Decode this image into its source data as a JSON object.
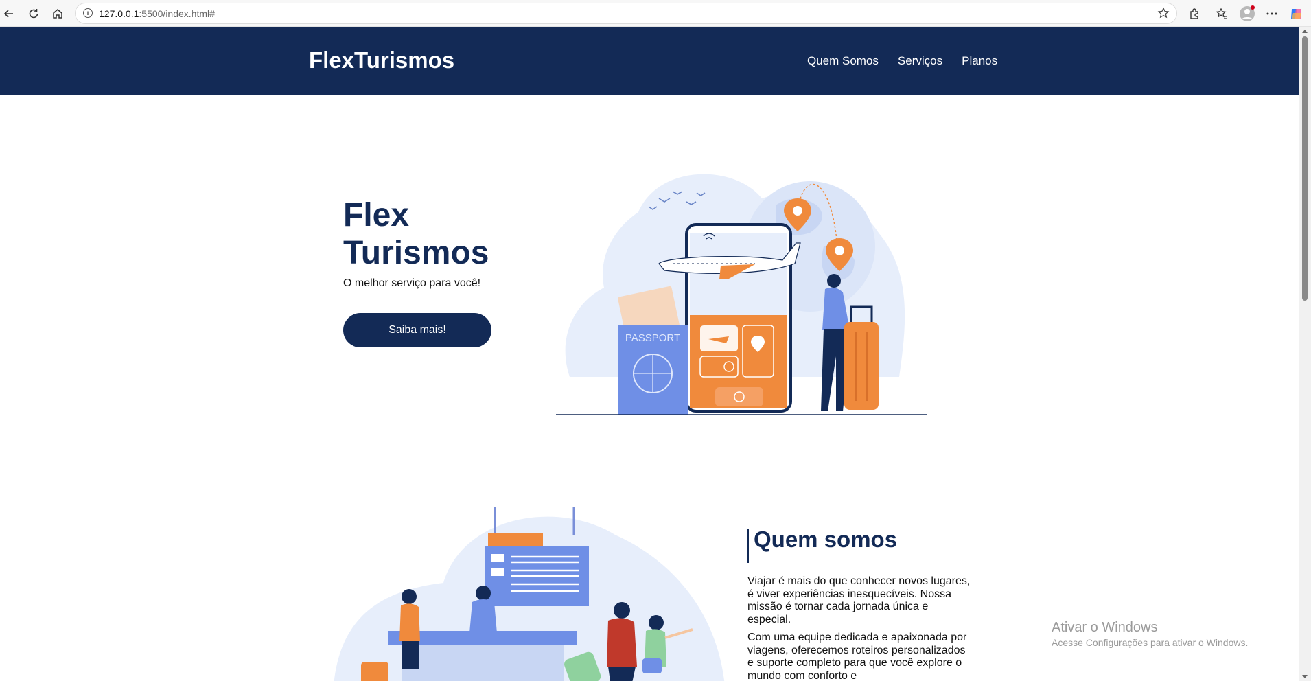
{
  "browser": {
    "url_host": "127.0.0.1",
    "url_rest": ":5500/index.html#"
  },
  "header": {
    "logo": "FlexTurismos",
    "nav": [
      "Quem Somos",
      "Serviços",
      "Planos"
    ]
  },
  "hero": {
    "title_line1": "Flex",
    "title_line2": "Turismos",
    "subtitle": "O melhor serviço para você!",
    "cta": "Saiba mais!",
    "illustration_label": "PASSPORT"
  },
  "about": {
    "title": "Quem somos",
    "paragraph1": "Viajar é mais do que conhecer novos lugares, é viver experiências inesquecíveis. Nossa missão é tornar cada jornada única e especial.",
    "paragraph2": "Com uma equipe dedicada e apaixonada por viagens, oferecemos roteiros personalizados e suporte completo para que você explore o mundo com conforto e"
  },
  "watermark": {
    "line1": "Ativar o Windows",
    "line2": "Acesse Configurações para ativar o Windows."
  },
  "colors": {
    "brand": "#132a56",
    "accent": "#f08a3c",
    "soft_blue": "#e7eefb"
  },
  "icons": [
    "back-icon",
    "reload-icon",
    "home-icon",
    "info-icon",
    "star-icon",
    "extensions-icon",
    "favorites-icon",
    "profile-icon",
    "more-icon",
    "copilot-icon"
  ]
}
